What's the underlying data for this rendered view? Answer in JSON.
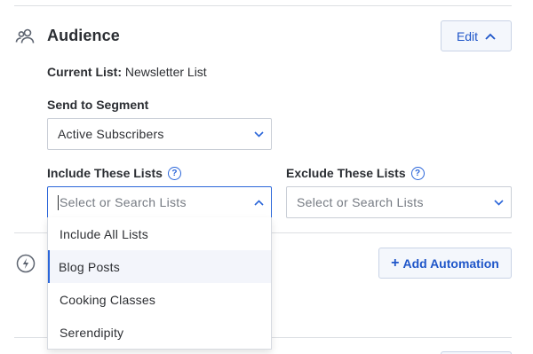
{
  "audience": {
    "title": "Audience",
    "edit_label": "Edit",
    "current_list_label": "Current List:",
    "current_list_value": "Newsletter List"
  },
  "segment": {
    "label": "Send to Segment",
    "value": "Active Subscribers"
  },
  "include": {
    "label": "Include These Lists",
    "placeholder": "Select or Search Lists",
    "options": [
      "Include All Lists",
      "Blog Posts",
      "Cooking Classes",
      "Serendipity"
    ],
    "highlighted": "Blog Posts"
  },
  "exclude": {
    "label": "Exclude These Lists",
    "placeholder": "Select or Search Lists"
  },
  "automation": {
    "plus": "+",
    "add_label": "Add Automation"
  },
  "colors": {
    "accent": "#2b66d9",
    "button_text": "#1f56c9",
    "button_bg": "#f4f7fc"
  },
  "icons": {
    "audience": "people-icon",
    "help": "question-circle-icon",
    "chevron": "chevron-down-icon",
    "automation": "lightning-bolt-icon"
  }
}
